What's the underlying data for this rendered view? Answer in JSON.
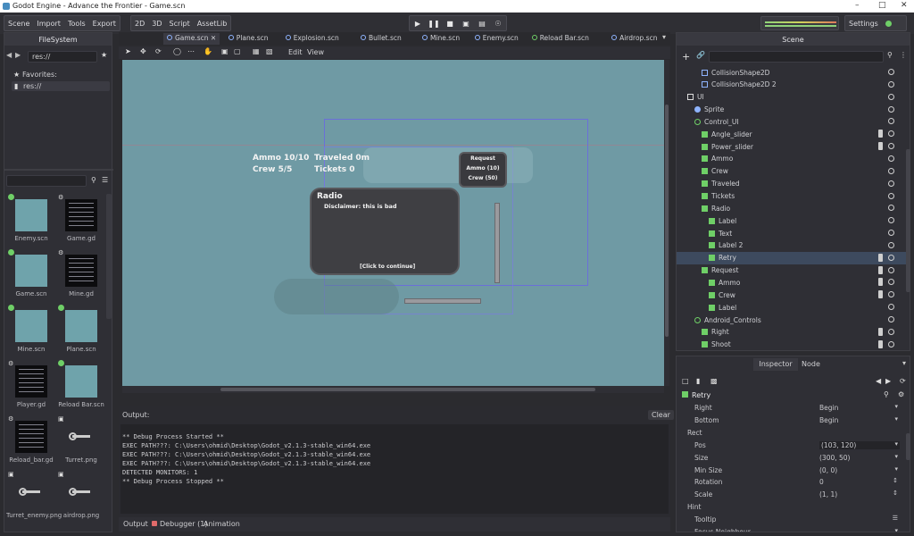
{
  "window": {
    "title": "Godot Engine - Advance the Frontier - Game.scn"
  },
  "menu": {
    "scene": "Scene",
    "import": "Import",
    "tools": "Tools",
    "export": "Export"
  },
  "modes": {
    "m2d": "2D",
    "m3d": "3D",
    "script": "Script",
    "assetlib": "AssetLib"
  },
  "settings": {
    "label": "Settings"
  },
  "filesystem": {
    "tab": "FileSystem",
    "path": "res://",
    "favorites": "Favorites:",
    "root": "res://",
    "files": [
      {
        "name": "Enemy.scn",
        "kind": "scene"
      },
      {
        "name": "Game.gd",
        "kind": "script"
      },
      {
        "name": "Game.scn",
        "kind": "scene"
      },
      {
        "name": "Mine.gd",
        "kind": "script"
      },
      {
        "name": "Mine.scn",
        "kind": "scene"
      },
      {
        "name": "Plane.scn",
        "kind": "scene"
      },
      {
        "name": "Player.gd",
        "kind": "script"
      },
      {
        "name": "Reload Bar.scn",
        "kind": "scene"
      },
      {
        "name": "Reload_bar.gd",
        "kind": "script"
      },
      {
        "name": "Turret.png",
        "kind": "image"
      },
      {
        "name": "Turret_enemy.png",
        "kind": "image"
      },
      {
        "name": "airdrop.png",
        "kind": "image"
      }
    ]
  },
  "tabs": [
    "Game.scn",
    "Plane.scn",
    "Explosion.scn",
    "Bullet.scn",
    "Mine.scn",
    "Enemy.scn",
    "Reload Bar.scn",
    "Airdrop.scn"
  ],
  "viewport_toolbar": {
    "edit": "Edit",
    "view": "View"
  },
  "game": {
    "ammo": "Ammo 10/10",
    "crew": "Crew 5/5",
    "traveled": "Traveled 0m",
    "tickets": "Tickets 0",
    "radio_title": "Radio",
    "disclaimer": "Disclaimer: this is bad",
    "continue": "[Click to continue]",
    "request": "Request",
    "request_ammo": "Ammo (10)",
    "request_crew": "Crew (50)"
  },
  "scene_panel": {
    "tab": "Scene",
    "nodes": [
      {
        "label": "CollisionShape2D",
        "indent": 3,
        "icon": "outline"
      },
      {
        "label": "CollisionShape2D 2",
        "indent": 3,
        "icon": "outline"
      },
      {
        "label": "UI",
        "indent": 1,
        "icon": "caret"
      },
      {
        "label": "Sprite",
        "indent": 2,
        "icon": "sprite"
      },
      {
        "label": "Control_UI",
        "indent": 2,
        "icon": "circle"
      },
      {
        "label": "Angle_slider",
        "indent": 3,
        "icon": "green"
      },
      {
        "label": "Power_slider",
        "indent": 3,
        "icon": "green"
      },
      {
        "label": "Ammo",
        "indent": 3,
        "icon": "green"
      },
      {
        "label": "Crew",
        "indent": 3,
        "icon": "green"
      },
      {
        "label": "Traveled",
        "indent": 3,
        "icon": "green"
      },
      {
        "label": "Tickets",
        "indent": 3,
        "icon": "green"
      },
      {
        "label": "Radio",
        "indent": 3,
        "icon": "green"
      },
      {
        "label": "Label",
        "indent": 4,
        "icon": "green"
      },
      {
        "label": "Text",
        "indent": 4,
        "icon": "green"
      },
      {
        "label": "Label 2",
        "indent": 4,
        "icon": "green"
      },
      {
        "label": "Retry",
        "indent": 4,
        "icon": "green"
      },
      {
        "label": "Request",
        "indent": 3,
        "icon": "green"
      },
      {
        "label": "Ammo",
        "indent": 4,
        "icon": "green"
      },
      {
        "label": "Crew",
        "indent": 4,
        "icon": "green"
      },
      {
        "label": "Label",
        "indent": 4,
        "icon": "green"
      },
      {
        "label": "Android_Controls",
        "indent": 2,
        "icon": "circle"
      },
      {
        "label": "Right",
        "indent": 3,
        "icon": "green"
      },
      {
        "label": "Shoot",
        "indent": 3,
        "icon": "green"
      }
    ]
  },
  "inspector": {
    "tab_inspector": "Inspector",
    "tab_node": "Node",
    "node": "Retry",
    "props": [
      {
        "key": "Right",
        "value": "Begin"
      },
      {
        "key": "Bottom",
        "value": "Begin"
      },
      {
        "key": "Rect",
        "value": ""
      },
      {
        "key": "Pos",
        "value": "(103, 120)"
      },
      {
        "key": "Size",
        "value": "(300, 50)"
      },
      {
        "key": "Min Size",
        "value": "(0, 0)"
      },
      {
        "key": "Rotation",
        "value": "0"
      },
      {
        "key": "Scale",
        "value": "(1, 1)"
      },
      {
        "key": "Hint",
        "value": ""
      },
      {
        "key": "Tooltip",
        "value": ""
      },
      {
        "key": "Focus Neighbour",
        "value": ""
      }
    ]
  },
  "output": {
    "title": "Output:",
    "clear": "Clear",
    "lines": [
      "** Debug Process Started **",
      "EXEC PATH???: C:\\Users\\ohmid\\Desktop\\Godot_v2.1.3-stable_win64.exe",
      "EXEC PATH???: C:\\Users\\ohmid\\Desktop\\Godot_v2.1.3-stable_win64.exe",
      "EXEC PATH???: C:\\Users\\ohmid\\Desktop\\Godot_v2.1.3-stable_win64.exe",
      "DETECTED MONITORS: 1",
      "** Debug Process Stopped **"
    ],
    "tabs": [
      "Output",
      "Debugger (1)",
      "Animation"
    ]
  }
}
